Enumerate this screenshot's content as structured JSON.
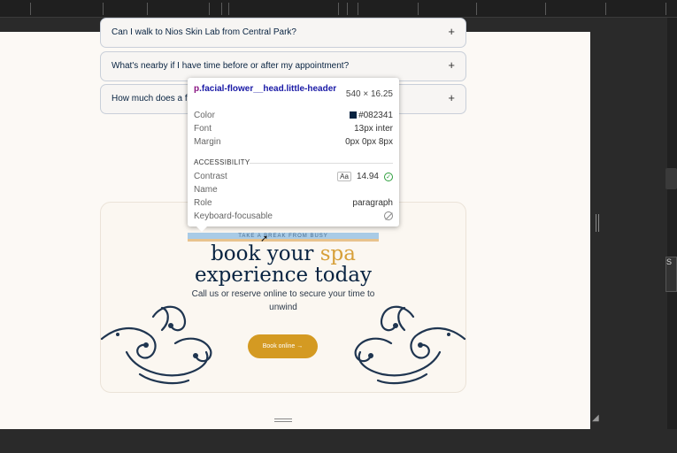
{
  "faq": [
    {
      "question": "Can I walk to Nios Skin Lab from Central Park?",
      "toggle": "+"
    },
    {
      "question": "What's nearby if I have time before or after my appointment?",
      "toggle": "+"
    },
    {
      "question": "How much does a f",
      "toggle": "+"
    }
  ],
  "booking": {
    "eyebrow": "TAKE A BREAK FROM BUSY",
    "title_part1": "book your ",
    "title_accent": "spa",
    "title_line2": "experience today",
    "subtitle_line1": "Call us or reserve online to secure your time to",
    "subtitle_line2": "unwind",
    "button_label": "Book online  →"
  },
  "inspector": {
    "selector_tag": "p",
    "selector_class": ".facial-flower__head.little-header",
    "dimensions": "540 × 16.25",
    "rows": [
      {
        "key": "Color",
        "value": "#082341"
      },
      {
        "key": "Font",
        "value": "13px inter"
      },
      {
        "key": "Margin",
        "value": "0px 0px 8px"
      }
    ],
    "accessibility_heading": "ACCESSIBILITY",
    "contrast_label": "Contrast",
    "contrast_badge": "Aa",
    "contrast_value": "14.94",
    "name_label": "Name",
    "role_label": "Role",
    "role_value": "paragraph",
    "focusable_label": "Keyboard-focusable"
  },
  "colors": {
    "text_primary": "#082341",
    "accent": "#d7a03a",
    "button": "#d49a22"
  },
  "rail": {
    "button_label": "S"
  }
}
